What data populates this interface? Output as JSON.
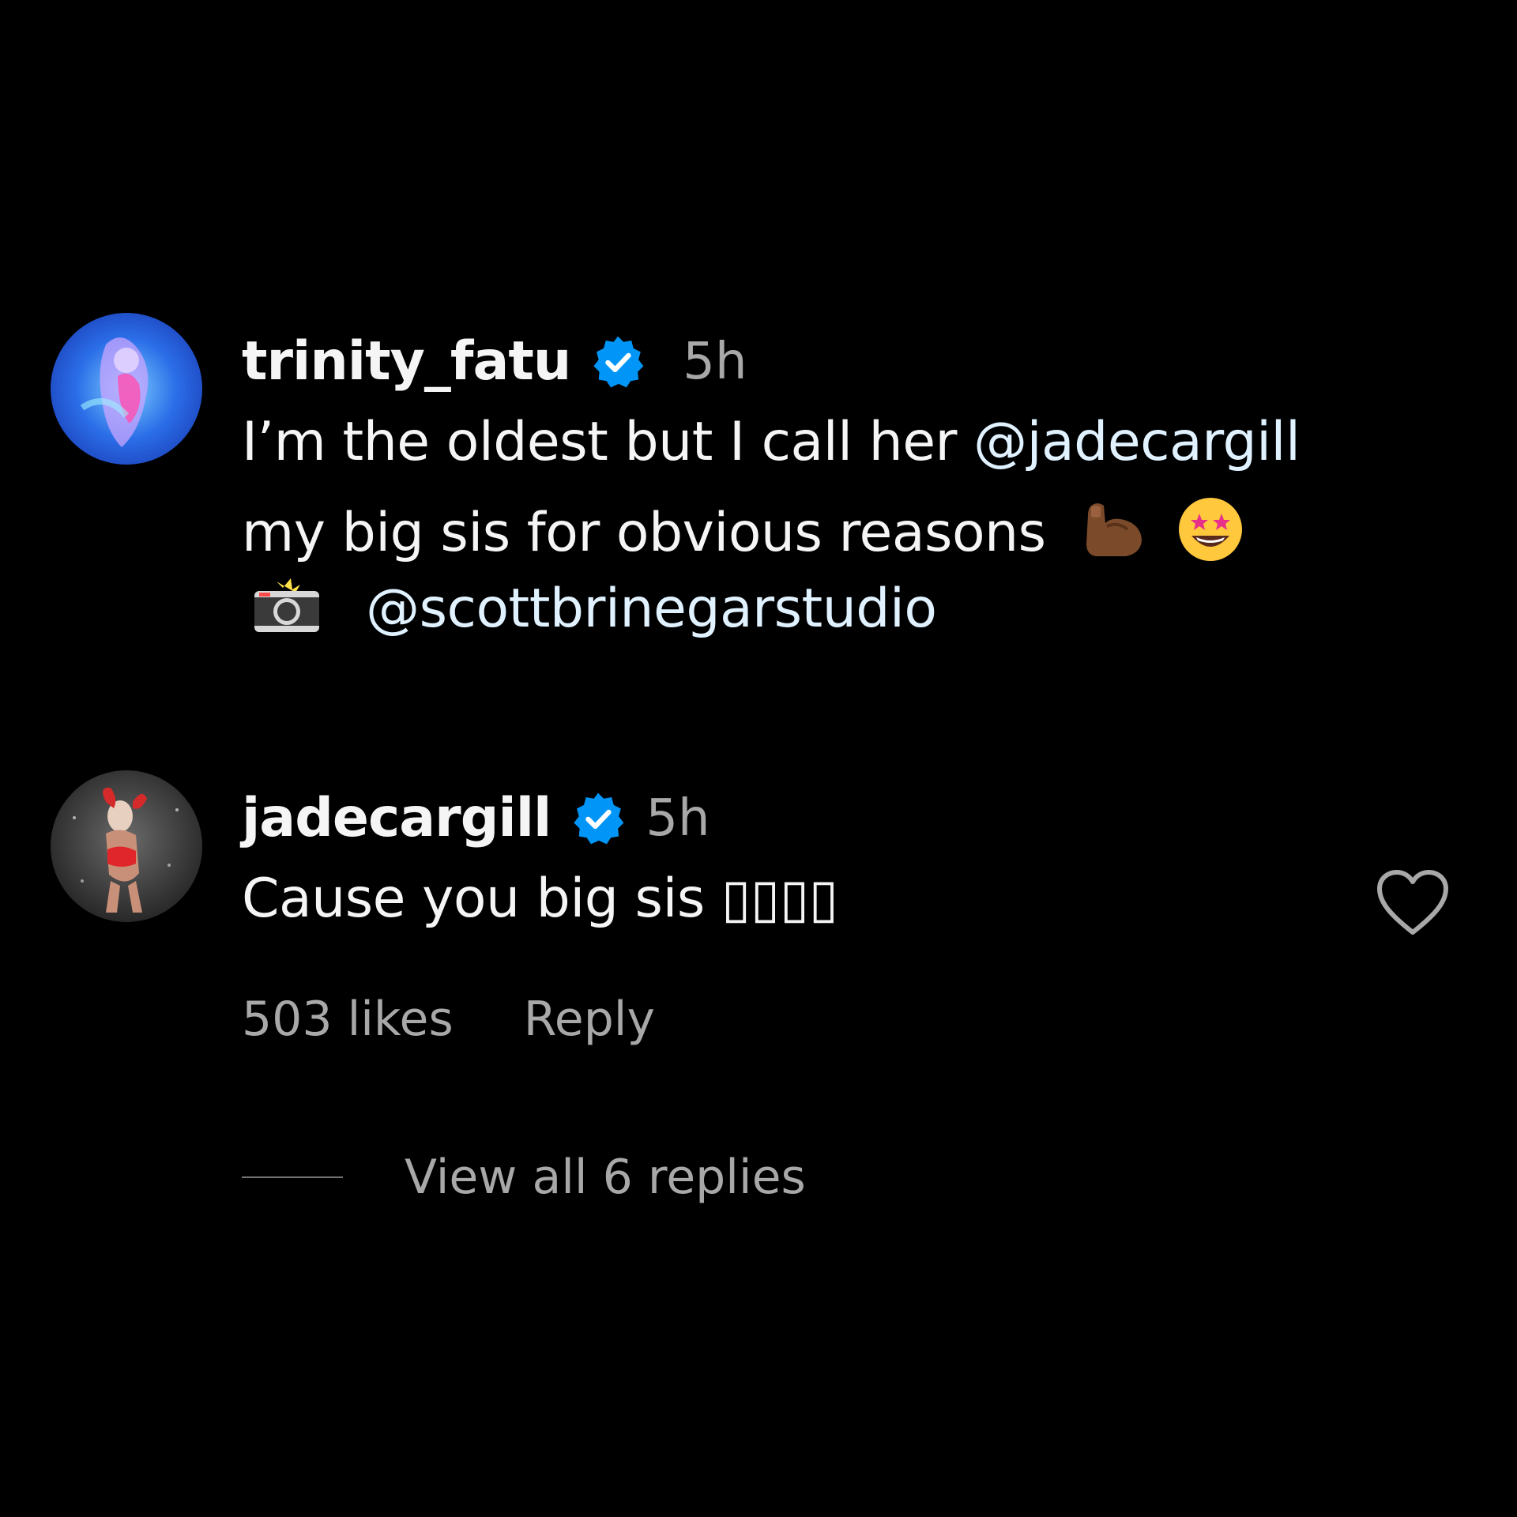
{
  "comments": [
    {
      "username": "trinity_fatu",
      "verified": true,
      "time": "5h",
      "lines": {
        "l1_text": "I’m the oldest but I call her ",
        "l1_mention": "@jadecargill",
        "l2_text": "my big sis for obvious reasons ",
        "l2_emojis": [
          "flexed-biceps-emoji",
          "star-struck-emoji"
        ],
        "l3_emoji": "camera-with-flash-emoji",
        "l3_mention": "@scottbrinegarstudio"
      }
    },
    {
      "username": "jadecargill",
      "verified": true,
      "time": "5h",
      "text": "Cause you big sis ▯▯▯▯",
      "likes": "503 likes",
      "reply_label": "Reply",
      "view_replies": "View all 6 replies"
    }
  ],
  "colors": {
    "background": "#000000",
    "text": "#f5f5f5",
    "muted": "#a8a8a8",
    "verified_badge": "#0095f6",
    "mention": "#e0f1ff"
  }
}
